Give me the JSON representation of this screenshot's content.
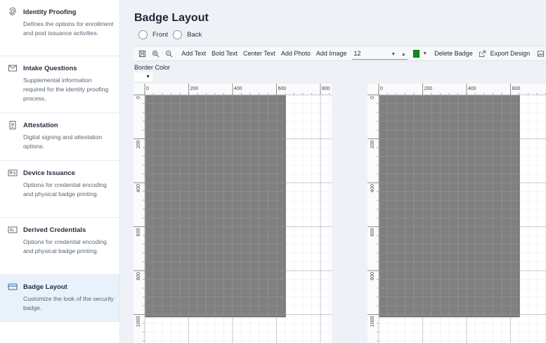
{
  "sidebar": {
    "items": [
      {
        "icon": "fingerprint-icon",
        "title": "Identity Proofing",
        "desc": "Defines the options for enrollment and post issuance activities."
      },
      {
        "icon": "mail-icon",
        "title": "Intake Questions",
        "desc": "Supplemental information required for the identity proofing process."
      },
      {
        "icon": "document-sign-icon",
        "title": "Attestation",
        "desc": "Digital signing and attestation options."
      },
      {
        "icon": "id-card-icon",
        "title": "Device Issuance",
        "desc": "Options for credential encoding and physical badge printing."
      },
      {
        "icon": "credential-icon",
        "title": "Derived Credentials",
        "desc": "Options for credential encoding and physical badge printing."
      },
      {
        "icon": "badge-layout-icon",
        "title": "Badge Layout",
        "desc": "Customize the look of the security badge.",
        "active": true
      }
    ]
  },
  "main": {
    "title": "Badge Layout",
    "side_options": [
      "Front",
      "Back"
    ],
    "toolbar": {
      "save_icon": "save-icon",
      "zoom_in_icon": "zoom-in-icon",
      "zoom_out_icon": "zoom-out-icon",
      "add_text": "Add Text",
      "bold_text": "Bold Text",
      "center_text": "Center Text",
      "add_photo": "Add Photo",
      "add_image": "Add Image",
      "font_size": "12",
      "color": "#138a1a",
      "delete_badge": "Delete Badge",
      "export_design": "Export Design"
    },
    "border_color_label": "Border Color",
    "canvas": {
      "x_ticks": [
        "0",
        "200",
        "400",
        "600",
        "800"
      ],
      "y_ticks": [
        "0",
        "200",
        "400",
        "600",
        "800",
        "1000"
      ],
      "badge_fill": "#808080"
    }
  }
}
